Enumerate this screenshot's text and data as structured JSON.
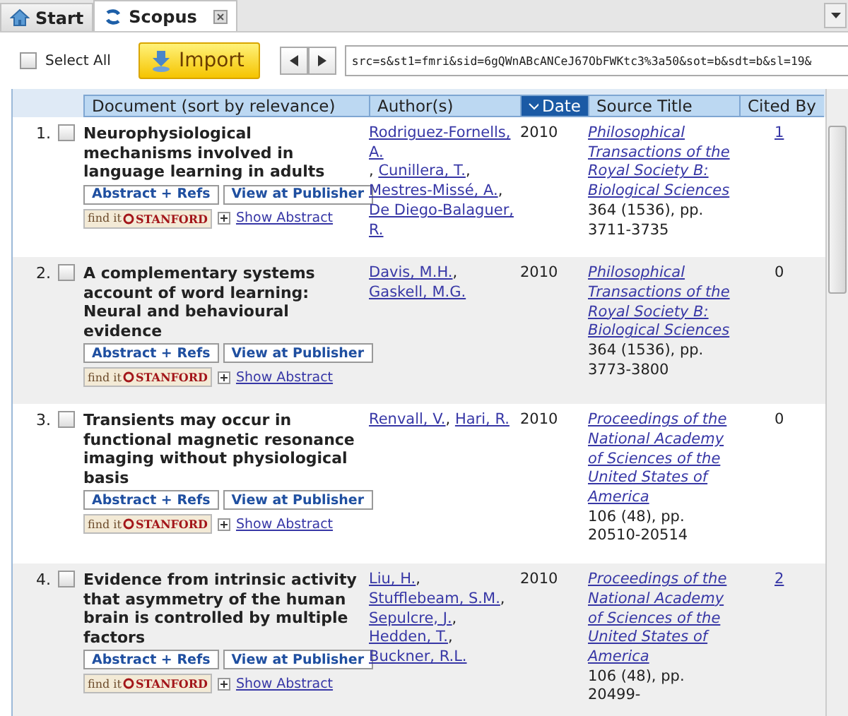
{
  "tabs": [
    {
      "label": "Start",
      "selected": false,
      "closable": false
    },
    {
      "label": "Scopus",
      "selected": true,
      "closable": true
    }
  ],
  "toolbar": {
    "select_all": {
      "label": "Select All",
      "checked": false
    },
    "import_button": "Import",
    "url": "src=s&st1=fmri&sid=6gQWnABcANCeJ67ObFWKtc3%3a50&sot=b&sdt=b&sl=19&"
  },
  "table": {
    "columns": [
      {
        "label": "Document (sort by relevance)",
        "sorted": false
      },
      {
        "label": "Author(s)",
        "sorted": false
      },
      {
        "label": "Date",
        "sorted": true
      },
      {
        "label": "Source Title",
        "sorted": false
      },
      {
        "label": "Cited By",
        "sorted": false
      }
    ],
    "rows": [
      {
        "number": "1.",
        "checked": false,
        "title": "Neurophysiological mechanisms involved in language learning in adults",
        "buttons": [
          "Abstract + Refs",
          "View at Publisher"
        ],
        "findit": [
          "find it",
          "STANFORD"
        ],
        "show_abstract": "Show Abstract",
        "authors": [
          {
            "name": "Rodriguez-Fornells, A.",
            "sep": ","
          },
          {
            "name": "Cunillera, T.",
            "sep": ","
          },
          {
            "name": "Mestres-Missé, A.",
            "sep": ","
          },
          {
            "name": "De Diego-Balaguer, R."
          }
        ],
        "date": "2010",
        "journal": "Philosophical Transactions of the Royal Society B: Biological Sciences",
        "details": "364 (1536), pp. 3711-3735",
        "cited": "1",
        "cited_link": true
      },
      {
        "number": "2.",
        "checked": false,
        "title": "A complementary systems account of word learning: Neural and behavioural evidence",
        "buttons": [
          "Abstract + Refs",
          "View at Publisher"
        ],
        "findit": [
          "find it",
          "STANFORD"
        ],
        "show_abstract": "Show Abstract",
        "authors": [
          {
            "name": "Davis, M.H.",
            "sep": ","
          },
          {
            "name": "Gaskell, M.G."
          }
        ],
        "date": "2010",
        "journal": "Philosophical Transactions of the Royal Society B: Biological Sciences",
        "details": "364 (1536), pp. 3773-3800",
        "cited": "0",
        "cited_link": false
      },
      {
        "number": "3.",
        "checked": false,
        "title": "Transients may occur in functional magnetic resonance imaging without physiological basis",
        "buttons": [
          "Abstract + Refs",
          "View at Publisher"
        ],
        "findit": [
          "find it",
          "STANFORD"
        ],
        "show_abstract": "Show Abstract",
        "authors": [
          {
            "name": "Renvall, V.",
            "sep": ","
          },
          {
            "name": "Hari, R."
          }
        ],
        "date": "2010",
        "journal": "Proceedings of the National Academy of Sciences of the United States of America",
        "details": "106 (48), pp. 20510-20514",
        "cited": "0",
        "cited_link": false
      },
      {
        "number": "4.",
        "checked": false,
        "title": "Evidence from intrinsic activity that asymmetry of the human brain is controlled by multiple factors",
        "buttons": [
          "Abstract + Refs",
          "View at Publisher"
        ],
        "findit": [
          "find it",
          "STANFORD"
        ],
        "show_abstract": "Show Abstract",
        "authors": [
          {
            "name": "Liu, H.",
            "sep": ","
          },
          {
            "name": "Stufflebeam, S.M.",
            "sep": ","
          },
          {
            "name": "Sepulcre, J.",
            "sep": ","
          },
          {
            "name": "Hedden, T.",
            "sep": ","
          },
          {
            "name": "Buckner, R.L."
          }
        ],
        "date": "2010",
        "journal": "Proceedings of the National Academy of Sciences of the United States of America",
        "details": "106 (48), pp. 20499-",
        "cited": "2",
        "cited_link": true
      }
    ]
  }
}
